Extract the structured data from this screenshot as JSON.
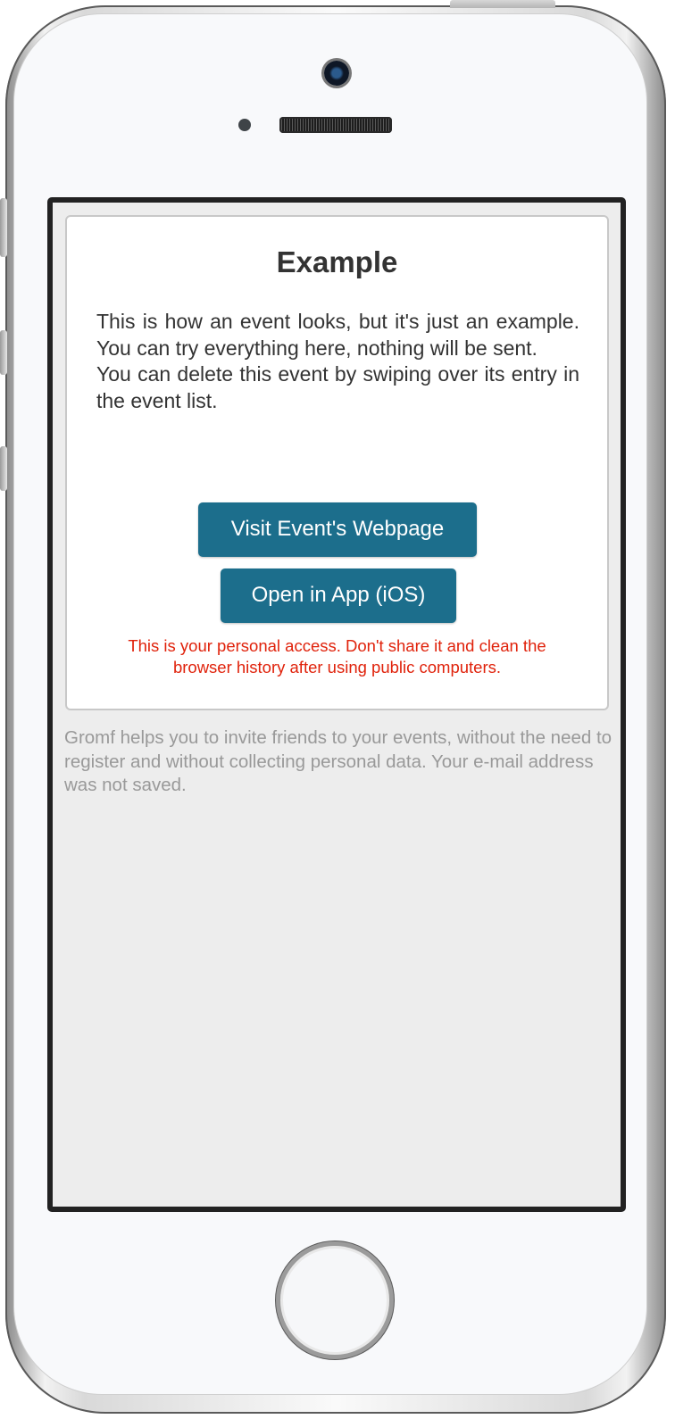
{
  "card": {
    "title": "Example",
    "body_line1": "This is how an event looks, but it's just an example. You can try everything here, nothing will be sent.",
    "body_line2": "You can delete this event by swiping over its entry in the event list.",
    "visit_button_label": "Visit Event's Webpage",
    "open_app_button_label": "Open in App (iOS)",
    "warning_line1": "This is your personal access. Don't share it and clean the",
    "warning_line2": "browser history after using public computers."
  },
  "footer": {
    "note": "Gromf helps you to invite friends to your events, without the need to register and without collecting personal data. Your e-mail address was not saved."
  },
  "colors": {
    "button": "#1c6e8c",
    "warning": "#e0220b",
    "footer_text": "#999999",
    "screen_background": "#ededed"
  }
}
